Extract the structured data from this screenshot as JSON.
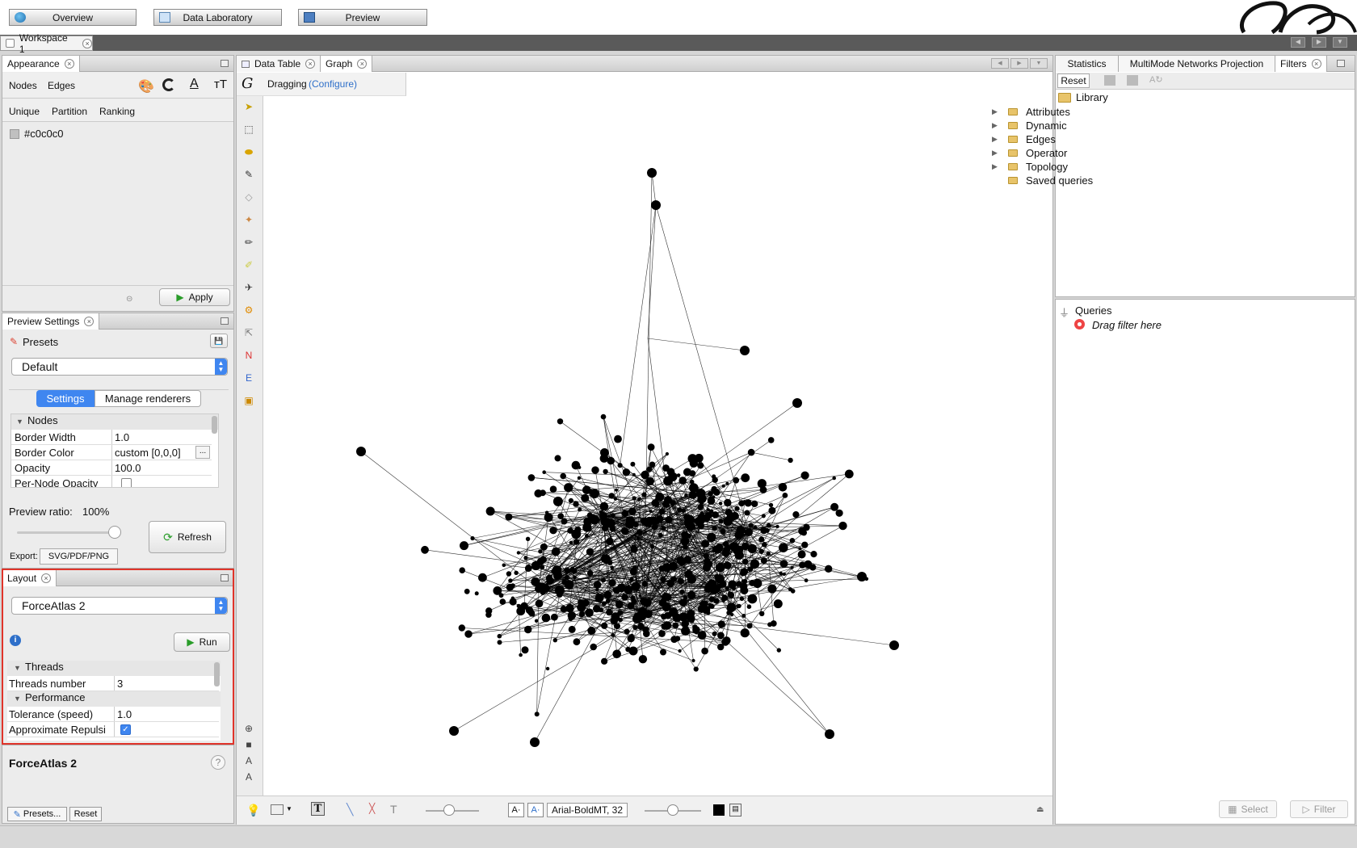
{
  "topbar": {
    "overview": "Overview",
    "data_laboratory": "Data Laboratory",
    "preview": "Preview"
  },
  "workspace": {
    "tab": "Workspace 1"
  },
  "appearance": {
    "title": "Appearance",
    "nodes": "Nodes",
    "edges": "Edges",
    "sub_tabs": [
      "Unique",
      "Partition",
      "Ranking"
    ],
    "color_value": "#c0c0c0",
    "apply": "Apply"
  },
  "preview_settings": {
    "title": "Preview Settings",
    "presets": "Presets",
    "preset_value": "Default",
    "settings_tab": "Settings",
    "manage_renderers_tab": "Manage renderers",
    "section": "Nodes",
    "props": [
      {
        "key": "Border Width",
        "value": "1.0"
      },
      {
        "key": "Border Color",
        "value": "custom [0,0,0]"
      },
      {
        "key": "Opacity",
        "value": "100.0"
      },
      {
        "key": "Per-Node Opacity",
        "value": ""
      }
    ],
    "ratio_label": "Preview ratio:",
    "ratio_value": "100%",
    "refresh": "Refresh",
    "export_label": "Export:",
    "export_value": "SVG/PDF/PNG"
  },
  "layout": {
    "title": "Layout",
    "algorithm": "ForceAtlas 2",
    "run": "Run",
    "sec_threads": "Threads",
    "threads_key": "Threads number",
    "threads_value": "3",
    "sec_performance": "Performance",
    "tolerance_key": "Tolerance (speed)",
    "tolerance_value": "1.0",
    "approx_key": "Approximate Repulsi",
    "approx_checked": true,
    "desc_title": "ForceAtlas 2",
    "presets_btn": "Presets...",
    "reset_btn": "Reset",
    "highlight_color": "#e0342a"
  },
  "graph": {
    "tab_data_table": "Data Table",
    "tab_graph": "Graph",
    "mode": "Dragging",
    "configure": "(Configure)",
    "font_label": "Arial-BoldMT, 32"
  },
  "right": {
    "tabs": [
      "Statistics",
      "MultiMode Networks Projection",
      "Filters"
    ],
    "reset": "Reset",
    "library": "Library",
    "library_items": [
      "Attributes",
      "Dynamic",
      "Edges",
      "Operator",
      "Topology",
      "Saved queries"
    ],
    "queries": "Queries",
    "drag_filter": "Drag filter here",
    "select": "Select",
    "filter": "Filter"
  }
}
